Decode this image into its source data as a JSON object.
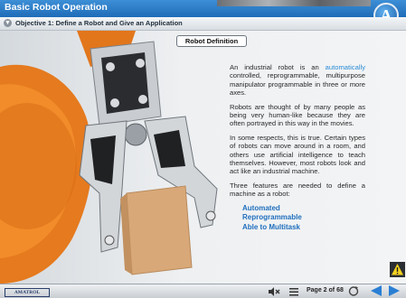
{
  "app": {
    "title": "Basic Robot Operation",
    "logo_letter": "A"
  },
  "objective": {
    "label": "Objective 1: Define a Robot and Give an Application"
  },
  "slide": {
    "tab_label": "Robot Definition",
    "p1_prefix": "An industrial robot is an ",
    "p1_link": "automatically",
    "p1_rest": " controlled, reprogrammable, multipurpose manipulator programmable in three or more axes.",
    "p2": "Robots are thought of by many people as being very human-like because they are often portrayed in this way in the movies.",
    "p3": "In some respects, this is true. Certain types of robots can move around in a room, and others use artificial intelligence to teach themselves. However, most robots look and act like an industrial machine.",
    "p4": "Three features are needed to define a machine as a robot:",
    "features": [
      "Automated",
      "Reprogrammable",
      "Able to Multitask"
    ]
  },
  "footer": {
    "brand": "AMATROL",
    "page_label": "Page 2 of 68"
  },
  "colors": {
    "title_bar": "#1f6cb8",
    "accent_text": "#2b8cd6",
    "feature_text": "#1f6fbd",
    "robot_orange": "#e57a1e",
    "nav_arrow": "#2a7fd4"
  },
  "icons": [
    "chevron-down-icon",
    "mute-icon",
    "menu-icon",
    "replay-icon",
    "back-arrow-icon",
    "next-arrow-icon",
    "warning-icon"
  ]
}
